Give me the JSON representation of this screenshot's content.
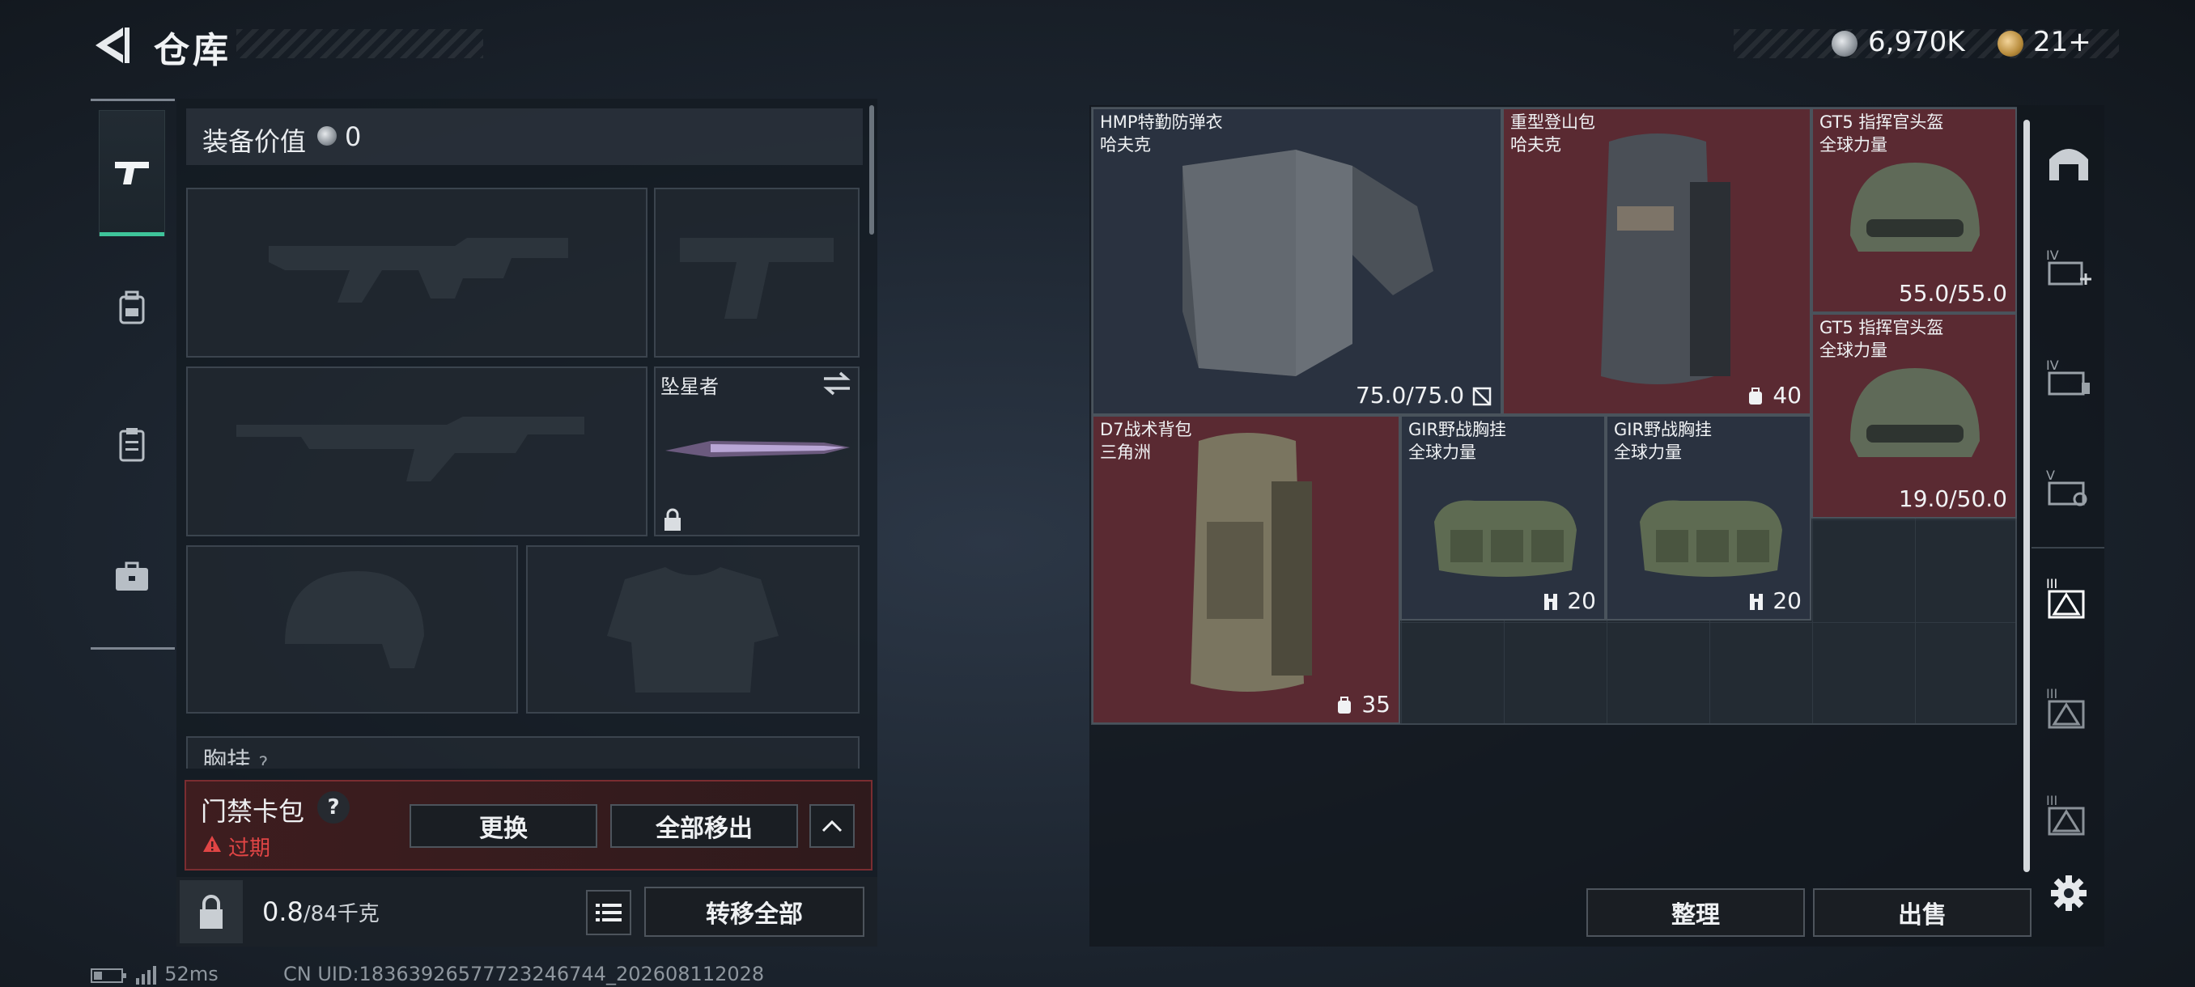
{
  "header": {
    "title": "仓库",
    "currency_silver": "6,970K",
    "currency_gold": "21+"
  },
  "loadout": {
    "value_label": "装备价值",
    "value": "0",
    "melee_name": "坠星者",
    "rig_label": "胸挂",
    "rig_icon_glyph": "?"
  },
  "keycard": {
    "title": "门禁卡包",
    "help": "?",
    "status": "过期",
    "replace_label": "更换",
    "move_all_label": "全部移出"
  },
  "footer": {
    "weight": "0.8",
    "weight_max": "/84千克",
    "transfer_label": "转移全部"
  },
  "status_bar": {
    "ping": "52ms",
    "uid": "CN UID:18363926577723246744_202608112028"
  },
  "stash": {
    "items": [
      {
        "name": "HMP特勤防弹衣",
        "brand": "哈夫克",
        "value": "75.0/75.0"
      },
      {
        "name": "重型登山包",
        "brand": "哈夫克",
        "value": "40"
      },
      {
        "name": "GT5 指挥官头盔",
        "brand": "全球力量",
        "value": "55.0/55.0"
      },
      {
        "name": "GT5 指挥官头盔",
        "brand": "全球力量",
        "value": "19.0/50.0"
      },
      {
        "name": "D7战术背包",
        "brand": "三角洲",
        "value": "35"
      },
      {
        "name": "GIR野战胸挂",
        "brand": "全球力量",
        "value": "20"
      },
      {
        "name": "GIR野战胸挂",
        "brand": "全球力量",
        "value": "20"
      }
    ],
    "sort_label": "整理",
    "sell_label": "出售"
  },
  "colors": {
    "accent": "#3ec49a",
    "red_rarity": "#5a2a32",
    "blue_rarity": "#2a3240",
    "expired": "#e04545"
  }
}
